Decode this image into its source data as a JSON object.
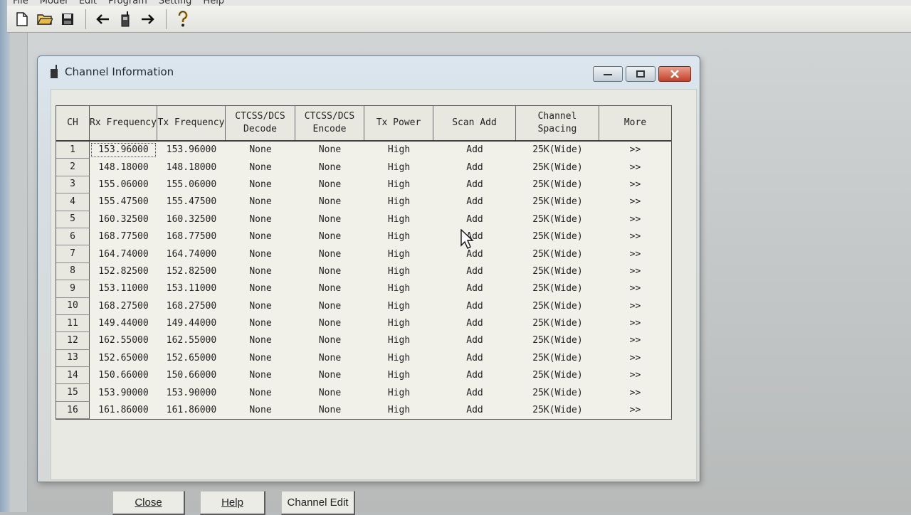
{
  "app": {
    "menu": [
      "File",
      "Model",
      "Edit",
      "Program",
      "Setting",
      "Help"
    ],
    "toolbar": [
      {
        "icon": "new-file-icon"
      },
      {
        "icon": "open-folder-icon"
      },
      {
        "icon": "save-icon"
      },
      {
        "icon": "read-from-radio-icon"
      },
      {
        "icon": "radio-icon"
      },
      {
        "icon": "write-to-radio-icon"
      },
      {
        "icon": "help-icon"
      }
    ]
  },
  "dialog": {
    "title": "Channel Information",
    "columns": {
      "ch": "CH",
      "rx": "Rx Frequency",
      "tx": "Tx Frequency",
      "decode": "CTCSS/DCS Decode",
      "encode": "CTCSS/DCS Encode",
      "power": "Tx Power",
      "scan": "Scan Add",
      "spacing": "Channel Spacing",
      "more": "More"
    },
    "rows": [
      {
        "ch": "1",
        "rx": "153.96000",
        "tx": "153.96000",
        "decode": "None",
        "encode": "None",
        "power": "High",
        "scan": "Add",
        "spacing": "25K(Wide)",
        "more": ">>"
      },
      {
        "ch": "2",
        "rx": "148.18000",
        "tx": "148.18000",
        "decode": "None",
        "encode": "None",
        "power": "High",
        "scan": "Add",
        "spacing": "25K(Wide)",
        "more": ">>"
      },
      {
        "ch": "3",
        "rx": "155.06000",
        "tx": "155.06000",
        "decode": "None",
        "encode": "None",
        "power": "High",
        "scan": "Add",
        "spacing": "25K(Wide)",
        "more": ">>"
      },
      {
        "ch": "4",
        "rx": "155.47500",
        "tx": "155.47500",
        "decode": "None",
        "encode": "None",
        "power": "High",
        "scan": "Add",
        "spacing": "25K(Wide)",
        "more": ">>"
      },
      {
        "ch": "5",
        "rx": "160.32500",
        "tx": "160.32500",
        "decode": "None",
        "encode": "None",
        "power": "High",
        "scan": "Add",
        "spacing": "25K(Wide)",
        "more": ">>"
      },
      {
        "ch": "6",
        "rx": "168.77500",
        "tx": "168.77500",
        "decode": "None",
        "encode": "None",
        "power": "High",
        "scan": "Add",
        "spacing": "25K(Wide)",
        "more": ">>"
      },
      {
        "ch": "7",
        "rx": "164.74000",
        "tx": "164.74000",
        "decode": "None",
        "encode": "None",
        "power": "High",
        "scan": "Add",
        "spacing": "25K(Wide)",
        "more": ">>"
      },
      {
        "ch": "8",
        "rx": "152.82500",
        "tx": "152.82500",
        "decode": "None",
        "encode": "None",
        "power": "High",
        "scan": "Add",
        "spacing": "25K(Wide)",
        "more": ">>"
      },
      {
        "ch": "9",
        "rx": "153.11000",
        "tx": "153.11000",
        "decode": "None",
        "encode": "None",
        "power": "High",
        "scan": "Add",
        "spacing": "25K(Wide)",
        "more": ">>"
      },
      {
        "ch": "10",
        "rx": "168.27500",
        "tx": "168.27500",
        "decode": "None",
        "encode": "None",
        "power": "High",
        "scan": "Add",
        "spacing": "25K(Wide)",
        "more": ">>"
      },
      {
        "ch": "11",
        "rx": "149.44000",
        "tx": "149.44000",
        "decode": "None",
        "encode": "None",
        "power": "High",
        "scan": "Add",
        "spacing": "25K(Wide)",
        "more": ">>"
      },
      {
        "ch": "12",
        "rx": "162.55000",
        "tx": "162.55000",
        "decode": "None",
        "encode": "None",
        "power": "High",
        "scan": "Add",
        "spacing": "25K(Wide)",
        "more": ">>"
      },
      {
        "ch": "13",
        "rx": "152.65000",
        "tx": "152.65000",
        "decode": "None",
        "encode": "None",
        "power": "High",
        "scan": "Add",
        "spacing": "25K(Wide)",
        "more": ">>"
      },
      {
        "ch": "14",
        "rx": "150.66000",
        "tx": "150.66000",
        "decode": "None",
        "encode": "None",
        "power": "High",
        "scan": "Add",
        "spacing": "25K(Wide)",
        "more": ">>"
      },
      {
        "ch": "15",
        "rx": "153.90000",
        "tx": "153.90000",
        "decode": "None",
        "encode": "None",
        "power": "High",
        "scan": "Add",
        "spacing": "25K(Wide)",
        "more": ">>"
      },
      {
        "ch": "16",
        "rx": "161.86000",
        "tx": "161.86000",
        "decode": "None",
        "encode": "None",
        "power": "High",
        "scan": "Add",
        "spacing": "25K(Wide)",
        "more": ">>"
      }
    ],
    "buttons": {
      "close": "Close",
      "help": "Help",
      "channel_edit": "Channel Edit"
    }
  }
}
